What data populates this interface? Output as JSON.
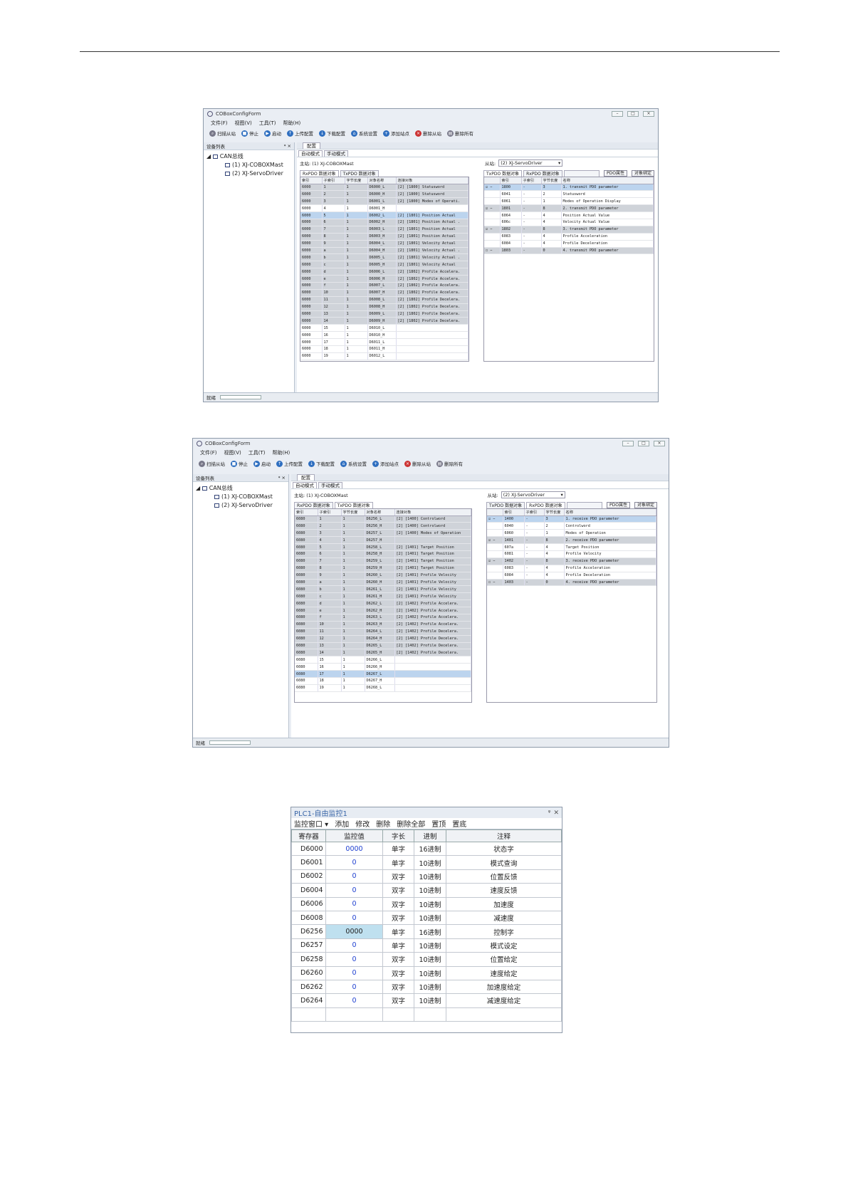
{
  "window1": {
    "title": "COBoxConfigForm",
    "menu": [
      "文件(F)",
      "视图(V)",
      "工具(T)",
      "帮助(H)"
    ],
    "toolbar": [
      "扫描从站",
      "停止",
      "启动",
      "上传配置",
      "下载配置",
      "系统设置",
      "添加站点",
      "删除从站",
      "删除所有"
    ],
    "device_list_label": "设备列表",
    "tree": {
      "root": "CAN总线",
      "master": "(1)   XJ-COBOXMast",
      "slave": "(2)   XJ-ServoDriver"
    },
    "doc_tab": "配置",
    "mode_tabs": [
      "自动模式",
      "手动模式"
    ],
    "master_label": "主站: (1)  XJ-COBOXMast",
    "slave_label": "从站:",
    "slave_value": "(2)  XJ-ServoDriver",
    "left_tabs": [
      "RxPDO 数据对象",
      "TxPDO 数据对象"
    ],
    "right_tabs": [
      "TxPDO 数据对象",
      "RxPDO 数据对象"
    ],
    "btn_prop": "PDO属性",
    "btn_bind": "对象绑定",
    "left_headers": [
      "索引",
      "子索引",
      "字节长度",
      "对象名称",
      "连接对象"
    ],
    "left_rows": [
      [
        "6000",
        "1",
        "1",
        "D6000_L",
        "[2] [1800] Statusword"
      ],
      [
        "6000",
        "2",
        "1",
        "D6000_H",
        "[2] [1800] Statusword"
      ],
      [
        "6000",
        "3",
        "1",
        "D6001_L",
        "[2] [1800] Modes of Operati."
      ],
      [
        "6000",
        "4",
        "1",
        "D6001_H",
        ""
      ],
      [
        "6000",
        "5",
        "1",
        "D6002_L",
        "[2] [1801] Position Actual"
      ],
      [
        "6000",
        "6",
        "1",
        "D6002_H",
        "[2] [1801] Position Actual ."
      ],
      [
        "6000",
        "7",
        "1",
        "D6003_L",
        "[2] [1801] Position Actual"
      ],
      [
        "6000",
        "8",
        "1",
        "D6003_H",
        "[2] [1801] Position Actual"
      ],
      [
        "6000",
        "9",
        "1",
        "D6004_L",
        "[2] [1801] Velocity Actual"
      ],
      [
        "6000",
        "a",
        "1",
        "D6004_H",
        "[2] [1801] Velocity Actual ."
      ],
      [
        "6000",
        "b",
        "1",
        "D6005_L",
        "[2] [1801] Velocity Actual ."
      ],
      [
        "6000",
        "c",
        "1",
        "D6005_H",
        "[2] [1801] Velocity Actual"
      ],
      [
        "6000",
        "d",
        "1",
        "D6006_L",
        "[2] [1802] Profile Accelera."
      ],
      [
        "6000",
        "e",
        "1",
        "D6006_H",
        "[2] [1802] Profile Accelera."
      ],
      [
        "6000",
        "f",
        "1",
        "D6007_L",
        "[2] [1802] Profile Accelera."
      ],
      [
        "6000",
        "10",
        "1",
        "D6007_H",
        "[2] [1802] Profile Accelera."
      ],
      [
        "6000",
        "11",
        "1",
        "D6008_L",
        "[2] [1802] Profile Decelera."
      ],
      [
        "6000",
        "12",
        "1",
        "D6008_H",
        "[2] [1802] Profile Decelera."
      ],
      [
        "6000",
        "13",
        "1",
        "D6009_L",
        "[2] [1802] Profile Decelera."
      ],
      [
        "6000",
        "14",
        "1",
        "D6009_H",
        "[2] [1802] Profile Decelera."
      ],
      [
        "6000",
        "15",
        "1",
        "D6010_L",
        ""
      ],
      [
        "6000",
        "16",
        "1",
        "D6010_H",
        ""
      ],
      [
        "6000",
        "17",
        "1",
        "D6011_L",
        ""
      ],
      [
        "6000",
        "18",
        "1",
        "D6011_H",
        ""
      ],
      [
        "6000",
        "19",
        "1",
        "D6012_L",
        ""
      ]
    ],
    "right_headers": [
      "",
      "索引",
      "子索引",
      "字节长度",
      "名称"
    ],
    "right_rows": [
      [
        "☑ −",
        "1800",
        "-",
        "3",
        "1. transmit PDO parameter"
      ],
      [
        "",
        "6041",
        "-",
        "2",
        "Statusword"
      ],
      [
        "",
        "6061",
        "-",
        "1",
        "Modes of Operation Display"
      ],
      [
        "☑ −",
        "1801",
        "-",
        "8",
        "2. transmit PDO parameter"
      ],
      [
        "",
        "6064",
        "-",
        "4",
        "Position Actual Value"
      ],
      [
        "",
        "606c",
        "-",
        "4",
        "Velocity Actual Value"
      ],
      [
        "☑ −",
        "1802",
        "-",
        "8",
        "3. transmit PDO parameter"
      ],
      [
        "",
        "6083",
        "-",
        "4",
        "Profile Acceleration"
      ],
      [
        "",
        "6084",
        "-",
        "4",
        "Profile Deceleration"
      ],
      [
        "☐ −",
        "1803",
        "-",
        "0",
        "4. transmit PDO parameter"
      ]
    ],
    "status": "就绪"
  },
  "window2": {
    "title": "COBoxConfigForm",
    "menu": [
      "文件(F)",
      "视图(V)",
      "工具(T)",
      "帮助(H)"
    ],
    "toolbar": [
      "扫描从站",
      "停止",
      "启动",
      "上传配置",
      "下载配置",
      "系统设置",
      "添加站点",
      "删除从站",
      "删除所有"
    ],
    "device_list_label": "设备列表",
    "tree": {
      "root": "CAN总线",
      "master": "(1)   XJ-COBOXMast",
      "slave": "(2)   XJ-ServoDriver"
    },
    "doc_tab": "配置",
    "mode_tabs": [
      "自动模式",
      "手动模式"
    ],
    "master_label": "主站: (1)  XJ-COBOXMast",
    "slave_label": "从站:",
    "slave_value": "(2)  XJ-ServoDriver",
    "left_tabs": [
      "RxPDO 数据对象",
      "TxPDO 数据对象"
    ],
    "right_tabs": [
      "TxPDO 数据对象",
      "RxPDO 数据对象"
    ],
    "btn_prop": "PDO属性",
    "btn_bind": "对象绑定",
    "left_headers": [
      "索引",
      "子索引",
      "字节长度",
      "对象名称",
      "连接对象"
    ],
    "left_rows": [
      [
        "6080",
        "1",
        "1",
        "D6256_L",
        "[2] [1400] Controlword"
      ],
      [
        "6080",
        "2",
        "1",
        "D6256_H",
        "[2] [1400] Controlword"
      ],
      [
        "6080",
        "3",
        "1",
        "D6257_L",
        "[2] [1400] Modes of Operation"
      ],
      [
        "6080",
        "4",
        "1",
        "D6257_H",
        ""
      ],
      [
        "6080",
        "5",
        "1",
        "D6258_L",
        "[2] [1401] Target Position"
      ],
      [
        "6080",
        "6",
        "1",
        "D6258_H",
        "[2] [1401] Target Position"
      ],
      [
        "6080",
        "7",
        "1",
        "D6259_L",
        "[2] [1401] Target Position"
      ],
      [
        "6080",
        "8",
        "1",
        "D6259_H",
        "[2] [1401] Target Position"
      ],
      [
        "6080",
        "9",
        "1",
        "D6260_L",
        "[2] [1401] Profile Velocity"
      ],
      [
        "6080",
        "a",
        "1",
        "D6260_H",
        "[2] [1401] Profile Velocity"
      ],
      [
        "6080",
        "b",
        "1",
        "D6261_L",
        "[2] [1401] Profile Velocity"
      ],
      [
        "6080",
        "c",
        "1",
        "D6261_H",
        "[2] [1401] Profile Velocity"
      ],
      [
        "6080",
        "d",
        "1",
        "D6262_L",
        "[2] [1402] Profile Accelera."
      ],
      [
        "6080",
        "e",
        "1",
        "D6262_H",
        "[2] [1402] Profile Accelera."
      ],
      [
        "6080",
        "f",
        "1",
        "D6263_L",
        "[2] [1402] Profile Accelera."
      ],
      [
        "6080",
        "10",
        "1",
        "D6263_H",
        "[2] [1402] Profile Accelera."
      ],
      [
        "6080",
        "11",
        "1",
        "D6264_L",
        "[2] [1402] Profile Decelera."
      ],
      [
        "6080",
        "12",
        "1",
        "D6264_H",
        "[2] [1402] Profile Decelera."
      ],
      [
        "6080",
        "13",
        "1",
        "D6265_L",
        "[2] [1402] Profile Decelera."
      ],
      [
        "6080",
        "14",
        "1",
        "D6265_H",
        "[2] [1402] Profile Decelera."
      ],
      [
        "6080",
        "15",
        "1",
        "D6266_L",
        ""
      ],
      [
        "6080",
        "16",
        "1",
        "D6266_H",
        ""
      ],
      [
        "6080",
        "17",
        "1",
        "D6267_L",
        ""
      ],
      [
        "6080",
        "18",
        "1",
        "D6267_H",
        ""
      ],
      [
        "6080",
        "19",
        "1",
        "D6268_L",
        ""
      ]
    ],
    "right_headers": [
      "",
      "索引",
      "子索引",
      "字节长度",
      "名称"
    ],
    "right_rows": [
      [
        "☑ −",
        "1400",
        "-",
        "3",
        "1. receive PDO parameter"
      ],
      [
        "",
        "6040",
        "-",
        "2",
        "Controlword"
      ],
      [
        "",
        "6060",
        "-",
        "1",
        "Modes of Operation"
      ],
      [
        "☑ −",
        "1401",
        "-",
        "8",
        "2. receive PDO parameter"
      ],
      [
        "",
        "607a",
        "-",
        "4",
        "Target Position"
      ],
      [
        "",
        "6081",
        "-",
        "4",
        "Profile Velocity"
      ],
      [
        "☑ −",
        "1402",
        "-",
        "8",
        "3. receive PDO parameter"
      ],
      [
        "",
        "6083",
        "-",
        "4",
        "Profile Acceleration"
      ],
      [
        "",
        "6084",
        "-",
        "4",
        "Profile Deceleration"
      ],
      [
        "☐ −",
        "1403",
        "-",
        "0",
        "4. receive PDO parameter"
      ]
    ],
    "status": "就绪"
  },
  "monitor": {
    "title": "PLC1-自由监控1",
    "toolbar": [
      "监控窗口 ▾",
      "添加",
      "修改",
      "删除",
      "删除全部",
      "置顶",
      "置底"
    ],
    "headers": [
      "寄存器",
      "监控值",
      "字长",
      "进制",
      "注释"
    ],
    "rows": [
      [
        "D6000",
        "0000",
        "单字",
        "16进制",
        "状态字"
      ],
      [
        "D6001",
        "0",
        "单字",
        "10进制",
        "模式查询"
      ],
      [
        "D6002",
        "0",
        "双字",
        "10进制",
        "位置反馈"
      ],
      [
        "D6004",
        "0",
        "双字",
        "10进制",
        "速度反馈"
      ],
      [
        "D6006",
        "0",
        "双字",
        "10进制",
        "加速度"
      ],
      [
        "D6008",
        "0",
        "双字",
        "10进制",
        "减速度"
      ],
      [
        "D6256",
        "0000",
        "单字",
        "16进制",
        "控制字"
      ],
      [
        "D6257",
        "0",
        "单字",
        "10进制",
        "模式设定"
      ],
      [
        "D6258",
        "0",
        "双字",
        "10进制",
        "位置给定"
      ],
      [
        "D6260",
        "0",
        "双字",
        "10进制",
        "速度给定"
      ],
      [
        "D6262",
        "0",
        "双字",
        "10进制",
        "加速度给定"
      ],
      [
        "D6264",
        "0",
        "双字",
        "10进制",
        "减速度给定"
      ]
    ]
  }
}
